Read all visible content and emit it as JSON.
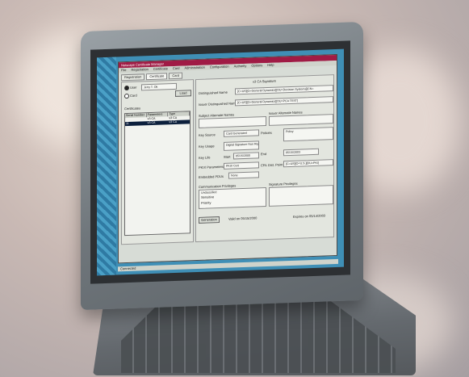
{
  "window": {
    "title": "Netscape Certificate Manager",
    "menu": [
      "File",
      "Registration",
      "Certificate",
      "Card",
      "Administration",
      "Configuration",
      "Authority",
      "Options",
      "Help"
    ],
    "tabs": [
      "Registration",
      "Certificate",
      "Card"
    ]
  },
  "left": {
    "radio_user": "User",
    "user_value": "Jerry T. Ok",
    "radio_card": "Card",
    "button_label": "Load",
    "list_title": "Certificates",
    "list_headers": [
      "Serial Number",
      "Parameters",
      "Type"
    ],
    "list_rows": [
      [
        "",
        "v3 CA",
        "v3 CA"
      ],
      [
        "11",
        "v3 CA",
        "v3 CA"
      ]
    ]
  },
  "right": {
    "header": "v3 CA Signature",
    "dn_label": "Distinguished Name",
    "dn_value": "[C=US][O=General Dynamics][OU=Decision Systems][CN=",
    "issuer_label": "Issuer Distinguished Name",
    "issuer_value": "[C=US][O=General Dynamics][OU=PCA TEST]",
    "subject_alt_label": "Subject Alternate Names",
    "issuer_alt_label": "Issuer Alternate Names",
    "key_source_label": "Key Source",
    "key_source_value": "Card Generated",
    "key_usage_label": "Key Usage",
    "key_usage_value": "Digital Signature Non Repudiation",
    "key_life_label": "Key Life",
    "start_label": "Start",
    "start_value": "05/15/2000",
    "end_label": "End",
    "end_value": "05/15/2003",
    "policies_label": "Policies",
    "policy_value": "Policy",
    "pkix_label": "PKIX Parameters",
    "pkix_value": "PKIX Cert",
    "crl_label": "CRL Dist. Point",
    "crl_value": "[C=US][O=U.S.][OU=PKI]",
    "encoded_label": "Embedded PDUs",
    "encoded_value": "None",
    "comm_label": "Communication Privileges",
    "comm_items": [
      "Unclassified",
      "Sensitive",
      "Priority"
    ],
    "sig_label": "Signature Privileges",
    "generation_label": "Generation",
    "valid_value": "Valid on 05/15/2000",
    "expires_value": "Expires on 05/14/2003"
  },
  "status": "Connected"
}
